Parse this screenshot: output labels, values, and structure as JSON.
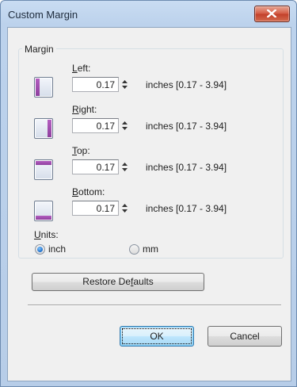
{
  "window": {
    "title": "Custom Margin"
  },
  "group": {
    "legend": "Margin"
  },
  "fields": [
    {
      "key": "left",
      "label_u": "L",
      "label_rest": "eft:",
      "value": "0.17",
      "range": "inches [0.17 - 3.94]"
    },
    {
      "key": "right",
      "label_u": "R",
      "label_rest": "ight:",
      "value": "0.17",
      "range": "inches [0.17 - 3.94]"
    },
    {
      "key": "top",
      "label_u": "T",
      "label_rest": "op:",
      "value": "0.17",
      "range": "inches [0.17 - 3.94]"
    },
    {
      "key": "bottom",
      "label_u": "B",
      "label_rest": "ottom:",
      "value": "0.17",
      "range": "inches [0.17 - 3.94]"
    }
  ],
  "units": {
    "label_u": "U",
    "label_rest": "nits:",
    "options": [
      {
        "label": "inch",
        "selected": true
      },
      {
        "label": "mm",
        "selected": false
      }
    ]
  },
  "buttons": {
    "restore_pre": "Restore De",
    "restore_u": "f",
    "restore_post": "aults",
    "ok": "OK",
    "cancel": "Cancel"
  },
  "icons": {
    "close": "close-x-icon",
    "left": "left-margin-icon",
    "right": "right-margin-icon",
    "top": "top-margin-icon",
    "bottom": "bottom-margin-icon",
    "spin": "spin-arrows-icon"
  },
  "colors": {
    "accent": "#8e3f9e",
    "close_button": "#c2402a",
    "title_bar": "#c9dcf2"
  }
}
